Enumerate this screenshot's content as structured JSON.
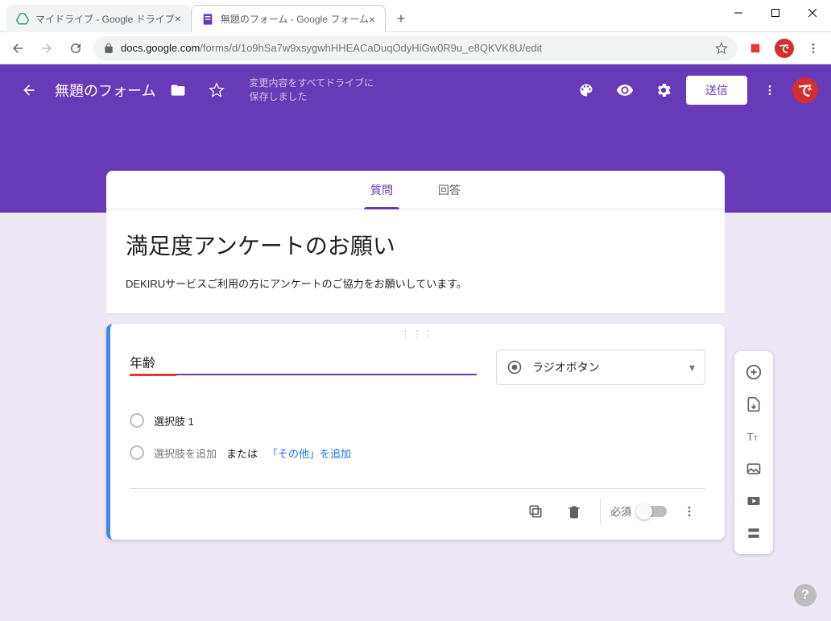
{
  "window": {
    "tabs": [
      {
        "title": "マイドライブ - Google ドライブ",
        "icon": "drive"
      },
      {
        "title": "無題のフォーム - Google フォーム",
        "icon": "forms"
      }
    ]
  },
  "urlbar": {
    "domain": "docs.google.com",
    "path": "/forms/d/1o9hSa7w9xsygwhHHEACaDuqOdyHiGw0R9u_e8QKVK8U/edit"
  },
  "header": {
    "form_title": "無題のフォーム",
    "save_status_line1": "変更内容をすべてドライブに",
    "save_status_line2": "保存しました",
    "send_label": "送信"
  },
  "form_tabs": {
    "questions": "質問",
    "responses": "回答"
  },
  "title_card": {
    "title": "満足度アンケートのお願い",
    "description": "DEKIRUサービスご利用の方にアンケートのご協力をお願いしています。"
  },
  "question": {
    "title": "年齢",
    "type_label": "ラジオボタン",
    "option1": "選択肢 1",
    "add_option": "選択肢を追加",
    "or": " または ",
    "add_other": "「その他」を追加",
    "required_label": "必須"
  },
  "help": "?"
}
